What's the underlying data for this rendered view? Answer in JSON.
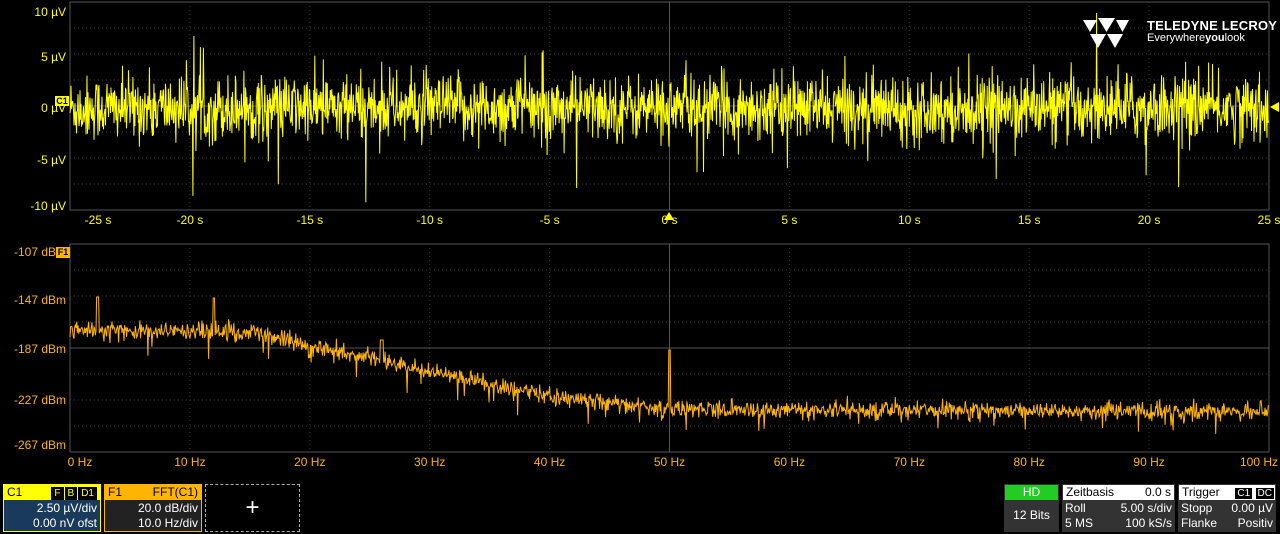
{
  "brand": {
    "name": "TELEDYNE LECROY",
    "tagline_pre": "Everywhere",
    "tagline_bold": "you",
    "tagline_post": "look"
  },
  "top_trace": {
    "y_labels": [
      "10 µV",
      "5 µV",
      "0 µV",
      "-5 µV",
      "-10 µV"
    ],
    "x_labels": [
      "-25 s",
      "-20 s",
      "-15 s",
      "-10 s",
      "-5 s",
      "0 s",
      "5 s",
      "10 s",
      "15 s",
      "20 s",
      "25 s"
    ],
    "marker": "C1",
    "color": "#ffff00"
  },
  "bottom_trace": {
    "y_labels": [
      "-107 dBm",
      "-147 dBm",
      "-187 dBm",
      "-227 dBm",
      "-267 dBm"
    ],
    "x_labels": [
      "0 Hz",
      "10 Hz",
      "20 Hz",
      "30 Hz",
      "40 Hz",
      "50 Hz",
      "60 Hz",
      "70 Hz",
      "80 Hz",
      "90 Hz",
      "100 Hz"
    ],
    "marker": "F1",
    "color": "#ffb400"
  },
  "c1_box": {
    "name": "C1",
    "tags": [
      "F",
      "B",
      "D1"
    ],
    "scale": "2.50 µV/div",
    "offset": "0.00 nV ofst"
  },
  "f1_box": {
    "name": "F1",
    "func": "FFT(C1)",
    "scale": "20.0 dB/div",
    "hscale": "10.0 Hz/div"
  },
  "add_button": "+",
  "hd_box": {
    "label": "HD",
    "bits": "12 Bits"
  },
  "timebase": {
    "title": "Zeitbasis",
    "delay": "0.0 s",
    "mode": "Roll",
    "tdiv": "5.00 s/div",
    "samples": "5 MS",
    "rate": "100 kS/s"
  },
  "trigger": {
    "title": "Trigger",
    "src": "C1",
    "coupling": "DC",
    "state": "Stopp",
    "level": "0.00 µV",
    "type": "Flanke",
    "slope": "Positiv"
  }
}
